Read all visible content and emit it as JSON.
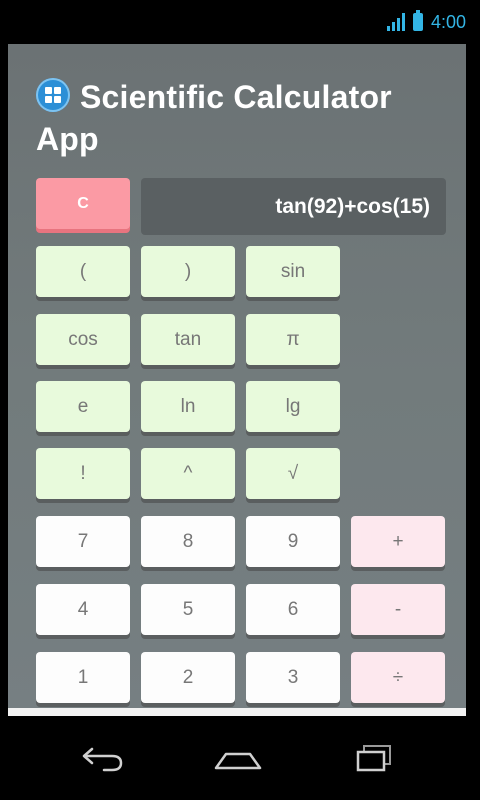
{
  "status_bar": {
    "time": "4:00",
    "signal_icon": "signal-icon",
    "battery_icon": "battery-icon",
    "accent_color": "#33b5e5"
  },
  "app": {
    "title": "Scientific Calculator App",
    "title_icon": "grid-app-icon",
    "display": "tan(92)+cos(15)",
    "clear_label": "C",
    "colors": {
      "clear_button": "#fb9aa4",
      "function_button": "#e8fadc",
      "number_button": "#fdfdfd",
      "operator_button": "#fde8ee",
      "display_background": "#5a6062"
    },
    "keys": {
      "open_paren": "(",
      "close_paren": ")",
      "sin": "sin",
      "cos": "cos",
      "tan": "tan",
      "pi": "π",
      "e": "e",
      "ln": "ln",
      "lg": "lg",
      "factorial": "!",
      "power": "^",
      "sqrt": "√",
      "seven": "7",
      "eight": "8",
      "nine": "9",
      "plus": "+",
      "four": "4",
      "five": "5",
      "six": "6",
      "minus": "-",
      "one": "1",
      "two": "2",
      "three": "3",
      "divide": "÷"
    }
  },
  "nav_bar": {
    "back_icon": "back-icon",
    "home_icon": "home-icon",
    "recents_icon": "recent-apps-icon"
  }
}
